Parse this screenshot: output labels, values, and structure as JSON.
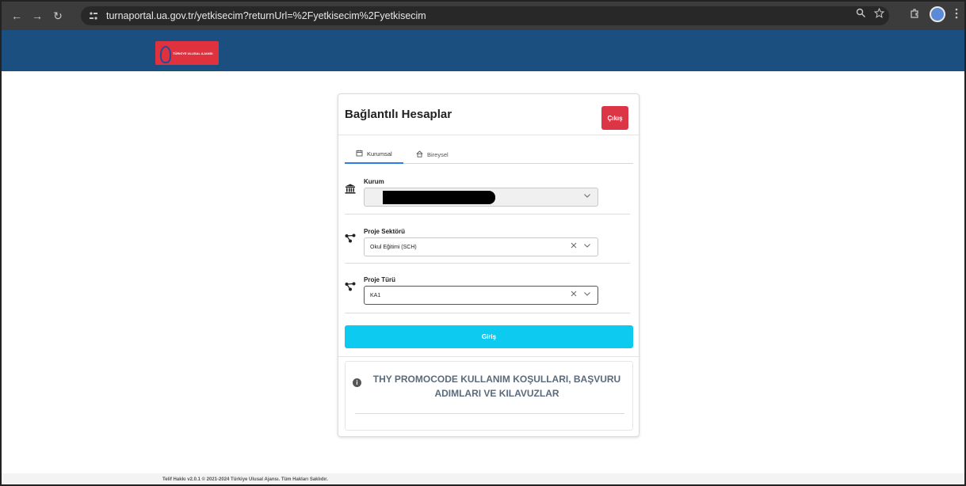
{
  "browser": {
    "url": "turnaportal.ua.gov.tr/yetkisecim?returnUrl=%2Fyetkisecim%2Fyetkisecim",
    "back_glyph": "←",
    "forward_glyph": "→",
    "reload_glyph": "↻"
  },
  "header": {
    "logo_text": "TÜRKİYE ULUSAL AJANSI"
  },
  "card": {
    "title": "Bağlantılı Hesaplar",
    "exit_label": "Çıkış",
    "tabs": [
      {
        "label": "Kurumsal",
        "icon": "building-icon",
        "active": true
      },
      {
        "label": "Bireysel",
        "icon": "home-icon",
        "active": false
      }
    ],
    "fields": {
      "kurum": {
        "label": "Kurum",
        "value": "",
        "icon": "institution-icon"
      },
      "sector": {
        "label": "Proje Sektörü",
        "value": "Okul Eğitimi (SCH)",
        "icon": "network-icon"
      },
      "type": {
        "label": "Proje Türü",
        "value": "KA1",
        "icon": "network-icon"
      }
    },
    "login_label": "Giriş",
    "info_text": "THY PROMOCODE KULLANIM KOŞULLARI, BAŞVURU ADIMLARI VE KILAVUZLAR"
  },
  "footer": {
    "text": "Telif Hakkı v2.0.1 © 2021-2024 Türkiye Ulusal Ajansı. Tüm Hakları Saklıdır."
  },
  "colors": {
    "header_bg": "#1b4f80",
    "exit_button": "#dc3545",
    "login_button": "#0dcaf0",
    "logo_bg": "#e0323e"
  }
}
